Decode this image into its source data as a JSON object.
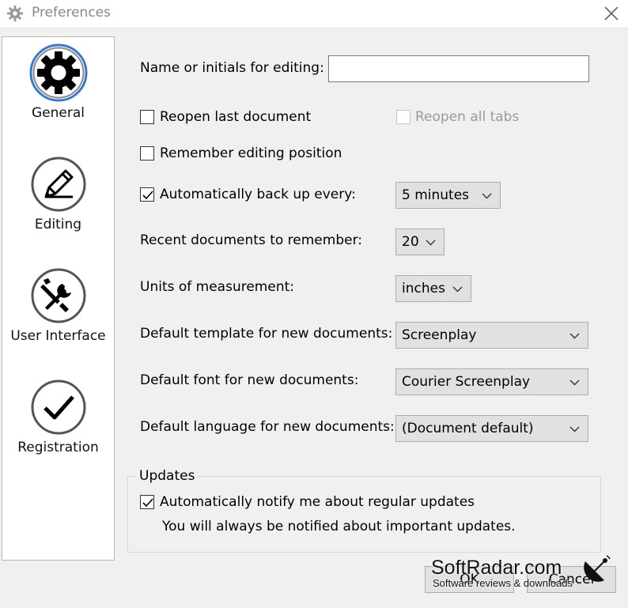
{
  "window": {
    "title": "Preferences",
    "icon": "gear-icon",
    "close_icon": "close-icon"
  },
  "sidebar": {
    "items": [
      {
        "label": "General",
        "icon": "gear-icon",
        "selected": true
      },
      {
        "label": "Editing",
        "icon": "pencil-icon",
        "selected": false
      },
      {
        "label": "User Interface",
        "icon": "wrench-screwdriver-icon",
        "selected": false
      },
      {
        "label": "Registration",
        "icon": "checkmark-icon",
        "selected": false
      }
    ]
  },
  "general": {
    "name_label": "Name or initials for editing:",
    "name_value": "",
    "reopen_last_label": "Reopen last document",
    "reopen_last_checked": false,
    "reopen_all_label": "Reopen all tabs",
    "reopen_all_checked": false,
    "reopen_all_enabled": false,
    "remember_position_label": "Remember editing position",
    "remember_position_checked": false,
    "auto_backup_label": "Automatically back up every:",
    "auto_backup_checked": true,
    "auto_backup_value": "5 minutes",
    "recent_label": "Recent documents to remember:",
    "recent_value": "20",
    "units_label": "Units of measurement:",
    "units_value": "inches",
    "template_label": "Default template for new documents:",
    "template_value": "Screenplay",
    "font_label": "Default font for new documents:",
    "font_value": "Courier Screenplay",
    "language_label": "Default language for new documents:",
    "language_value": "(Document default)"
  },
  "updates": {
    "group_title": "Updates",
    "notify_label": "Automatically notify me about regular updates",
    "notify_checked": true,
    "note": "You will always be notified about important updates."
  },
  "buttons": {
    "ok": "OK",
    "cancel": "Cancel"
  },
  "watermark": {
    "name": "SoftRadar.com",
    "tagline": "Software reviews & downloads"
  },
  "colors": {
    "selected_ring": "#3a78c9",
    "window_bg": "#f0f0f0",
    "sidebar_bg": "#ffffff"
  }
}
